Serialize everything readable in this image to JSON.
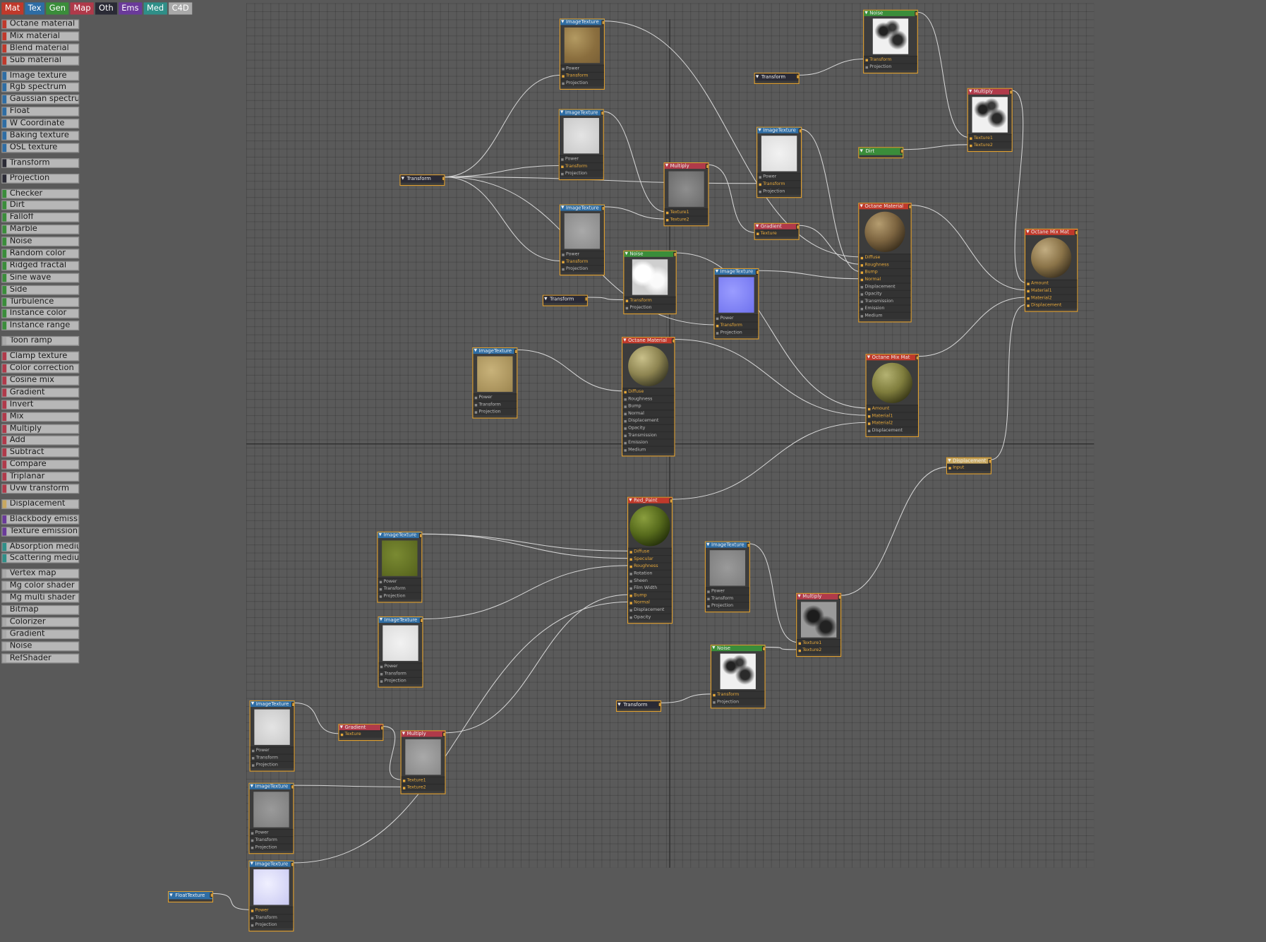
{
  "tabs": [
    {
      "label": "Mat",
      "color": "#c0392b"
    },
    {
      "label": "Tex",
      "color": "#2e6da4"
    },
    {
      "label": "Gen",
      "color": "#3a8d3a"
    },
    {
      "label": "Map",
      "color": "#b03a4a"
    },
    {
      "label": "Oth",
      "color": "#2a2a35"
    },
    {
      "label": "Ems",
      "color": "#6a3a9a"
    },
    {
      "label": "Med",
      "color": "#2f8f88"
    },
    {
      "label": "C4D",
      "color": "#a9a9a9"
    }
  ],
  "palette": [
    {
      "label": "Octane material",
      "color": "#c0392b"
    },
    {
      "label": "Mix material",
      "color": "#c0392b"
    },
    {
      "label": "Blend material",
      "color": "#c0392b"
    },
    {
      "label": "Sub material",
      "color": "#c0392b",
      "gap": true
    },
    {
      "label": "Image texture",
      "color": "#2e6da4"
    },
    {
      "label": "Rgb spectrum",
      "color": "#2e6da4"
    },
    {
      "label": "Gaussian spectrum",
      "color": "#2e6da4"
    },
    {
      "label": "Float",
      "color": "#2e6da4"
    },
    {
      "label": "W Coordinate",
      "color": "#2e6da4"
    },
    {
      "label": "Baking texture",
      "color": "#2e6da4"
    },
    {
      "label": "OSL texture",
      "color": "#2e6da4",
      "gap": true
    },
    {
      "label": "Transform",
      "color": "#2a2a35",
      "gap": true
    },
    {
      "label": "Projection",
      "color": "#2a2a35",
      "gap": true
    },
    {
      "label": "Checker",
      "color": "#3a8d3a"
    },
    {
      "label": "Dirt",
      "color": "#3a8d3a"
    },
    {
      "label": "Falloff",
      "color": "#3a8d3a"
    },
    {
      "label": "Marble",
      "color": "#3a8d3a"
    },
    {
      "label": "Noise",
      "color": "#3a8d3a"
    },
    {
      "label": "Random color",
      "color": "#3a8d3a"
    },
    {
      "label": "Ridged fractal",
      "color": "#3a8d3a"
    },
    {
      "label": "Sine wave",
      "color": "#3a8d3a"
    },
    {
      "label": "Side",
      "color": "#3a8d3a"
    },
    {
      "label": "Turbulence",
      "color": "#3a8d3a"
    },
    {
      "label": "Instance color",
      "color": "#3a8d3a"
    },
    {
      "label": "Instance range",
      "color": "#3a8d3a",
      "gap": true
    },
    {
      "label": "Toon ramp",
      "color": "#a9a9a9",
      "gap": true
    },
    {
      "label": "Clamp texture",
      "color": "#b03a4a"
    },
    {
      "label": "Color correction",
      "color": "#b03a4a"
    },
    {
      "label": "Cosine mix",
      "color": "#b03a4a"
    },
    {
      "label": "Gradient",
      "color": "#b03a4a"
    },
    {
      "label": "Invert",
      "color": "#b03a4a"
    },
    {
      "label": "Mix",
      "color": "#b03a4a"
    },
    {
      "label": "Multiply",
      "color": "#b03a4a"
    },
    {
      "label": "Add",
      "color": "#b03a4a"
    },
    {
      "label": "Subtract",
      "color": "#b03a4a"
    },
    {
      "label": "Compare",
      "color": "#b03a4a"
    },
    {
      "label": "Triplanar",
      "color": "#b03a4a"
    },
    {
      "label": "Uvw transform",
      "color": "#b03a4a",
      "gap": true
    },
    {
      "label": "Displacement",
      "color": "#c8a860",
      "gap": true
    },
    {
      "label": "Blackbody emission",
      "color": "#6a3a9a"
    },
    {
      "label": "Texture emission",
      "color": "#6a3a9a",
      "gap": true
    },
    {
      "label": "Absorption medium",
      "color": "#2f8f88"
    },
    {
      "label": "Scattering medium",
      "color": "#2f8f88",
      "gap": true
    },
    {
      "label": "Vertex map",
      "color": "#a9a9a9"
    },
    {
      "label": "Mg color shader",
      "color": "#a9a9a9"
    },
    {
      "label": "Mg multi shader",
      "color": "#a9a9a9"
    },
    {
      "label": "Bitmap",
      "color": "#a9a9a9"
    },
    {
      "label": "Colorizer",
      "color": "#a9a9a9"
    },
    {
      "label": "Gradient",
      "color": "#a9a9a9"
    },
    {
      "label": "Noise",
      "color": "#a9a9a9"
    },
    {
      "label": "RefShader",
      "color": "#a9a9a9"
    }
  ],
  "nodes": [
    {
      "id": "it1",
      "title": "ImageTexture",
      "headColor": "#2e6da4",
      "preview": "sand",
      "ports": [
        "Power",
        "Transform",
        "Projection"
      ],
      "active": [
        1
      ]
    },
    {
      "id": "it2",
      "title": "ImageTexture",
      "headColor": "#2e6da4",
      "preview": "lightgrey",
      "ports": [
        "Power",
        "Transform",
        "Projection"
      ],
      "active": [
        1
      ]
    },
    {
      "id": "it3",
      "title": "ImageTexture",
      "headColor": "#2e6da4",
      "preview": "grey",
      "ports": [
        "Power",
        "Transform",
        "Projection"
      ],
      "active": [
        1
      ]
    },
    {
      "id": "tr1",
      "title": "Transform",
      "headColor": "#2a2a35",
      "small": true
    },
    {
      "id": "mul1",
      "title": "Multiply",
      "headColor": "#b03a4a",
      "preview": "darkgrey",
      "ports": [
        "Texture1",
        "Texture2"
      ],
      "active": [
        0,
        1
      ]
    },
    {
      "id": "noise1",
      "title": "Noise",
      "headColor": "#3a8d3a",
      "preview": "cloudlight",
      "ports": [
        "Transform",
        "Projection"
      ],
      "active": [
        0
      ]
    },
    {
      "id": "tr2",
      "title": "Transform",
      "headColor": "#2a2a35",
      "small": true
    },
    {
      "id": "it4",
      "title": "ImageTexture",
      "headColor": "#2e6da4",
      "preview": "sandlight",
      "ports": [
        "Power",
        "Transform",
        "Projection"
      ],
      "active": []
    },
    {
      "id": "om1",
      "title": "Octane Material",
      "headColor": "#c0392b",
      "preview": "sphereolive",
      "sphere": true,
      "ports": [
        "Diffuse",
        "Roughness",
        "Bump",
        "Normal",
        "Displacement",
        "Opacity",
        "Transmission",
        "Emission",
        "Medium"
      ],
      "active": [
        0
      ]
    },
    {
      "id": "itn",
      "title": "ImageTexture",
      "headColor": "#2e6da4",
      "preview": "normal",
      "ports": [
        "Power",
        "Transform",
        "Projection"
      ],
      "active": [
        1
      ]
    },
    {
      "id": "it5",
      "title": "ImageTexture",
      "headColor": "#2e6da4",
      "preview": "verylight",
      "ports": [
        "Power",
        "Transform",
        "Projection"
      ],
      "active": [
        1
      ]
    },
    {
      "id": "grad1",
      "title": "Gradient",
      "headColor": "#b03a4a",
      "ports": [
        "Texture"
      ],
      "active": [
        0
      ]
    },
    {
      "id": "tr3",
      "title": "Transform",
      "headColor": "#2a2a35",
      "small": true
    },
    {
      "id": "noise2",
      "title": "Noise",
      "headColor": "#3a8d3a",
      "preview": "cloud",
      "ports": [
        "Transform",
        "Projection"
      ],
      "active": [
        0
      ]
    },
    {
      "id": "dirt",
      "title": "Dirt",
      "headColor": "#3a8d3a",
      "small": true
    },
    {
      "id": "mul2",
      "title": "Multiply",
      "headColor": "#b03a4a",
      "preview": "cloud",
      "ports": [
        "Texture1",
        "Texture2"
      ],
      "active": [
        0,
        1
      ]
    },
    {
      "id": "om2",
      "title": "Octane Material",
      "headColor": "#c0392b",
      "preview": "spherebrown",
      "sphere": true,
      "ports": [
        "Diffuse",
        "Roughness",
        "Bump",
        "Normal",
        "Displacement",
        "Opacity",
        "Transmission",
        "Emission",
        "Medium"
      ],
      "active": [
        0,
        1,
        2,
        3
      ]
    },
    {
      "id": "mix1",
      "title": "Octane Mix Mat",
      "headColor": "#c0392b",
      "preview": "spheremoss",
      "sphere": true,
      "ports": [
        "Amount",
        "Material1",
        "Material2",
        "Displacement"
      ],
      "active": [
        0,
        1,
        2
      ]
    },
    {
      "id": "mix2",
      "title": "Octane Mix Mat",
      "headColor": "#c0392b",
      "preview": "spherebrown2",
      "sphere": true,
      "ports": [
        "Amount",
        "Material1",
        "Material2",
        "Displacement"
      ],
      "active": [
        0,
        1,
        2,
        3
      ]
    },
    {
      "id": "disp",
      "title": "Displacement",
      "headColor": "#c8a860",
      "ports": [
        "Input"
      ],
      "active": [
        0
      ]
    },
    {
      "id": "red",
      "title": "Red_Paint",
      "headColor": "#c0392b",
      "preview": "spheregreen",
      "sphere": true,
      "ports": [
        "Diffuse",
        "Specular",
        "Roughness",
        "Rotation",
        "Sheen",
        "Film Width",
        "Bump",
        "Normal",
        "Displacement",
        "Opacity"
      ],
      "active": [
        0,
        1,
        2,
        6,
        7
      ]
    },
    {
      "id": "it6",
      "title": "ImageTexture",
      "headColor": "#2e6da4",
      "preview": "green",
      "ports": [
        "Power",
        "Transform",
        "Projection"
      ],
      "active": []
    },
    {
      "id": "it7",
      "title": "ImageTexture",
      "headColor": "#2e6da4",
      "preview": "verylight",
      "ports": [
        "Power",
        "Transform",
        "Projection"
      ],
      "active": []
    },
    {
      "id": "it8",
      "title": "ImageTexture",
      "headColor": "#2e6da4",
      "preview": "grey2",
      "ports": [
        "Power",
        "Transform",
        "Projection"
      ],
      "active": []
    },
    {
      "id": "mul3",
      "title": "Multiply",
      "headColor": "#b03a4a",
      "preview": "clouddark",
      "ports": [
        "Texture1",
        "Texture2"
      ],
      "active": [
        0,
        1
      ]
    },
    {
      "id": "noise3",
      "title": "Noise",
      "headColor": "#3a8d3a",
      "preview": "cloud",
      "ports": [
        "Transform",
        "Projection"
      ],
      "active": [
        0
      ]
    },
    {
      "id": "tr4",
      "title": "Transform",
      "headColor": "#2a2a35",
      "small": true
    },
    {
      "id": "it9",
      "title": "ImageTexture",
      "headColor": "#2e6da4",
      "preview": "lightgrey",
      "ports": [
        "Power",
        "Transform",
        "Projection"
      ],
      "active": []
    },
    {
      "id": "grad2",
      "title": "Gradient",
      "headColor": "#b03a4a",
      "ports": [
        "Texture"
      ],
      "active": [
        0
      ]
    },
    {
      "id": "mul4",
      "title": "Multiply",
      "headColor": "#b03a4a",
      "preview": "grey",
      "ports": [
        "Texture1",
        "Texture2"
      ],
      "active": [
        0,
        1
      ]
    },
    {
      "id": "it10",
      "title": "ImageTexture",
      "headColor": "#2e6da4",
      "preview": "grey2",
      "ports": [
        "Power",
        "Transform",
        "Projection"
      ],
      "active": []
    },
    {
      "id": "it11",
      "title": "ImageTexture",
      "headColor": "#2e6da4",
      "preview": "lavender",
      "ports": [
        "Power",
        "Transform",
        "Projection"
      ],
      "active": [
        0
      ]
    },
    {
      "id": "float",
      "title": "FloatTexture",
      "headColor": "#2e6da4",
      "small": true
    }
  ]
}
